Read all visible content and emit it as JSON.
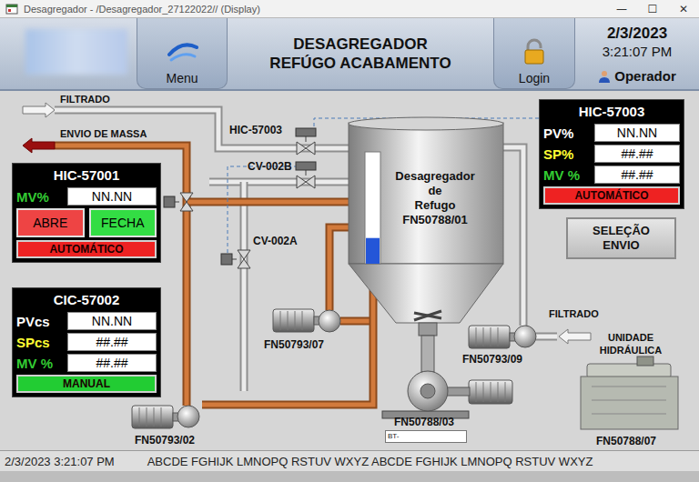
{
  "window": {
    "title": "Desagregador - /Desagregador_27122022// (Display)",
    "controls": [
      "—",
      "☐",
      "✕"
    ]
  },
  "header": {
    "title_lines": [
      "DESAGREGADOR",
      "REFÚGO ACABAMENTO"
    ],
    "menu": "Menu",
    "login": "Login",
    "date": "2/3/2023",
    "time": "3:21:07 PM",
    "user": "Operador"
  },
  "streams": [
    {
      "label": "FILTRADO",
      "kind": "inlet"
    },
    {
      "label": "ENVIO DE MASSA",
      "kind": "outlet"
    },
    {
      "label": "FILTRADO",
      "kind": "inlet"
    }
  ],
  "valves": [
    {
      "tag": "HIC-57003"
    },
    {
      "tag": "CV-002B"
    },
    {
      "tag": "CV-002A"
    }
  ],
  "tank": {
    "lines": [
      "Desagregador",
      "de",
      "Refugo",
      "FN50788/01"
    ],
    "level": 0.23
  },
  "pumps": [
    {
      "tag": "FN50793/07",
      "kind": "small",
      "badge": ""
    },
    {
      "tag": "FN50793/09",
      "kind": "small",
      "badge": ""
    },
    {
      "tag": "FN50793/02",
      "kind": "small",
      "badge": ""
    },
    {
      "tag": "FN50788/03",
      "kind": "large",
      "badge": "BT-"
    }
  ],
  "hydraulic_unit": {
    "lines": [
      "UNIDADE",
      "HIDRÁULICA"
    ],
    "tag": "FN50788/07"
  },
  "faceplates": [
    {
      "tag": "HIC-57001",
      "kind": "manual-valve",
      "rows": [
        {
          "label": "MV%",
          "value": "NN.NN",
          "color": "#33cc33"
        }
      ],
      "buttons": [
        {
          "label": "ABRE",
          "color": "#ee4444"
        },
        {
          "label": "FECHA",
          "color": "#33dd44"
        }
      ],
      "mode": {
        "label": "AUTOMÁTICO",
        "color": "#ee2222"
      }
    },
    {
      "tag": "CIC-57002",
      "kind": "controller",
      "rows": [
        {
          "label": "PVcs",
          "value": "NN.NN",
          "color": "#ffffff"
        },
        {
          "label": "SPcs",
          "value": "##.##",
          "color": "#ffff33"
        },
        {
          "label": "MV %",
          "value": "##.##",
          "color": "#33cc33"
        }
      ],
      "buttons": [],
      "mode": {
        "label": "MANUAL",
        "color": "#22cc33"
      }
    },
    {
      "tag": "HIC-57003",
      "kind": "controller",
      "rows": [
        {
          "label": "PV%",
          "value": "NN.NN",
          "color": "#ffffff"
        },
        {
          "label": "SP%",
          "value": "##.##",
          "color": "#ffff33"
        },
        {
          "label": "MV %",
          "value": "##.##",
          "color": "#33cc33"
        }
      ],
      "buttons": [],
      "mode": {
        "label": "AUTOMÁTICO",
        "color": "#ee2222"
      }
    }
  ],
  "selection_button": {
    "lines": [
      "SELEÇÃO",
      "ENVIO"
    ]
  },
  "status_bar": {
    "datetime": "2/3/2023 3:21:07 PM",
    "ticker": "ABCDE FGHIJK LMNOPQ RSTUV WXYZ ABCDE FGHIJK LMNOPQ RSTUV WXYZ"
  }
}
